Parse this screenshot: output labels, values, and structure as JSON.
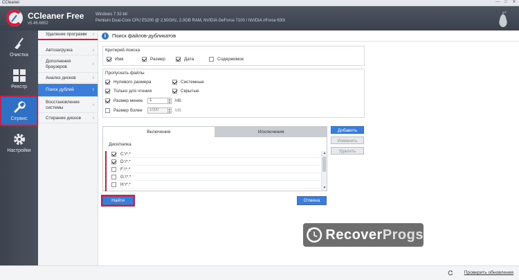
{
  "window": {
    "title": "CCleaner",
    "controls": [
      "—",
      "□",
      "✕"
    ]
  },
  "header": {
    "app_name": "CCleaner Free",
    "version": "v5.46.6652",
    "sys_line1": "Windows 7 32-bit",
    "sys_line2": "Pentium Dual-Core CPU E5200 @ 2,50GHz, 2,0GB RAM, NVIDIA GeForce 7100 / NVIDIA nForce 630i"
  },
  "sidebar": {
    "items": [
      {
        "label": "Очистка",
        "icon": "broom-icon"
      },
      {
        "label": "Реестр",
        "icon": "registry-grid-icon"
      },
      {
        "label": "Сервис",
        "icon": "wrench-icon",
        "active": true
      },
      {
        "label": "Настройки",
        "icon": "gear-icon"
      }
    ]
  },
  "subnav": {
    "items": [
      {
        "label": "Удаление программ"
      },
      {
        "label": "Автозагрузка"
      },
      {
        "label": "Дополнения браузеров"
      },
      {
        "label": "Анализ дисков"
      },
      {
        "label": "Поиск дублей",
        "active": true
      },
      {
        "label": "Восстановление системы"
      },
      {
        "label": "Стирание дисков"
      }
    ]
  },
  "page": {
    "title": "Поиск файлов-дубликатов"
  },
  "criteria": {
    "title": "Критерий поиска",
    "options": [
      {
        "label": "Имя",
        "checked": true
      },
      {
        "label": "Размер",
        "checked": true
      },
      {
        "label": "Дата",
        "checked": true
      },
      {
        "label": "Содержимое",
        "checked": false
      }
    ]
  },
  "skip": {
    "title": "Пропускать файлы",
    "zero_size": {
      "label": "Нулевого размера",
      "checked": true
    },
    "system": {
      "label": "Системные",
      "checked": true
    },
    "readonly": {
      "label": "Только для чтения",
      "checked": true
    },
    "hidden": {
      "label": "Скрытые",
      "checked": true
    },
    "size_less": {
      "label": "Размер менее",
      "checked": true,
      "value": "1",
      "unit": "MB"
    },
    "size_more": {
      "label": "Размер более",
      "checked": false,
      "value": "1000",
      "unit": "MB"
    }
  },
  "tabs": {
    "include": "Включения",
    "exclude": "Исключения"
  },
  "list": {
    "header": "Диск/папка",
    "rows": [
      {
        "path": "C:\\*.*",
        "checked": true
      },
      {
        "path": "D:\\*.*",
        "checked": true
      },
      {
        "path": "F:\\*.*",
        "checked": false
      },
      {
        "path": "G:\\*.*",
        "checked": false
      },
      {
        "path": "H:\\*.*",
        "checked": false
      }
    ]
  },
  "side_buttons": {
    "add": "Добавить",
    "edit": "Изменить",
    "remove": "Удалить"
  },
  "actions": {
    "find": "Найти",
    "cancel": "Отмена"
  },
  "watermark": {
    "part1": "Recover",
    "part2": "Progs"
  },
  "footer": {
    "check_updates": "Проверить обновления"
  }
}
